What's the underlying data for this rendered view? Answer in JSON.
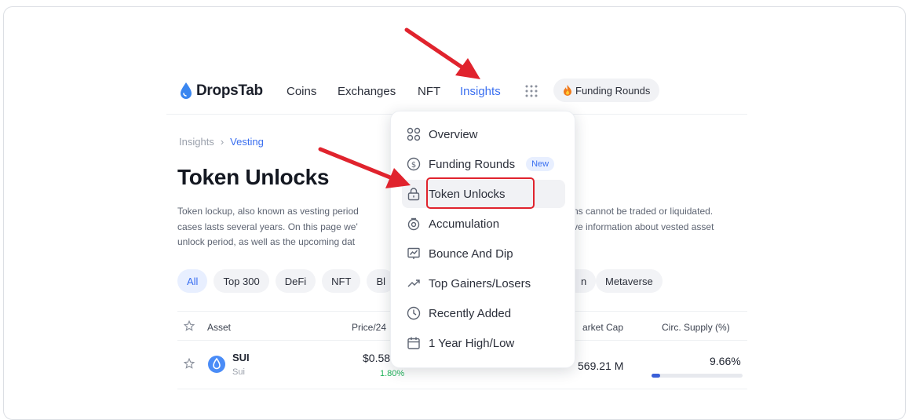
{
  "nav": {
    "brand": "DropsTab",
    "links": [
      "Coins",
      "Exchanges",
      "NFT",
      "Insights"
    ],
    "funding_pill": "Funding Rounds"
  },
  "breadcrumb": {
    "root": "Insights",
    "current": "Vesting"
  },
  "page": {
    "title": "Token Unlocks",
    "desc_lines": [
      "Token lockup, also known as vesting period",
      "cases lasts several years. On this page we'",
      "unlock period, as well as the upcoming dat"
    ],
    "desc_right_lines": [
      "ns cannot be traded or liquidated.",
      "ve information about vested asset",
      ""
    ]
  },
  "chips": [
    "All",
    "Top 300",
    "DeFi",
    "NFT",
    "Bl",
    "n",
    "Metaverse"
  ],
  "table": {
    "headers": {
      "asset": "Asset",
      "price": "Price/24",
      "market_cap": "arket Cap",
      "circ_supply": "Circ. Supply (%)"
    },
    "rows": [
      {
        "name": "SUI",
        "subname": "Sui",
        "price": "$0.58",
        "change": "1.80%",
        "market_cap": "569.21 M",
        "circ_supply": "9.66%",
        "circ_fraction": 0.0966
      }
    ]
  },
  "menu": {
    "items": [
      {
        "label": "Overview",
        "icon": "overview-icon"
      },
      {
        "label": "Funding Rounds",
        "icon": "dollar-circle-icon",
        "badge": "New"
      },
      {
        "label": "Token Unlocks",
        "icon": "lock-icon"
      },
      {
        "label": "Accumulation",
        "icon": "coin-stack-icon"
      },
      {
        "label": "Bounce And Dip",
        "icon": "chart-board-icon"
      },
      {
        "label": "Top Gainers/Losers",
        "icon": "trend-up-icon"
      },
      {
        "label": "Recently Added",
        "icon": "clock-icon"
      },
      {
        "label": "1 Year High/Low",
        "icon": "calendar-icon"
      }
    ]
  },
  "colors": {
    "accent": "#3a6ff0",
    "annotation": "#e0232d",
    "positive": "#21b35a"
  }
}
